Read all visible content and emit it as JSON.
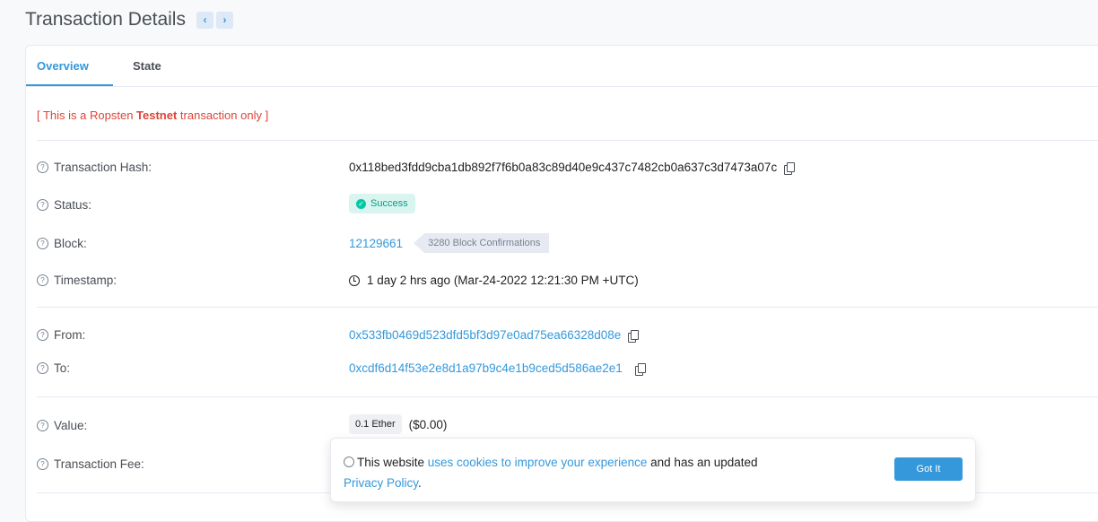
{
  "header": {
    "title": "Transaction Details",
    "prev_icon": "‹",
    "next_icon": "›"
  },
  "tabs": [
    {
      "label": "Overview"
    },
    {
      "label": "State"
    }
  ],
  "notice": {
    "prefix": "[ This is a Ropsten ",
    "strong": "Testnet",
    "suffix": " transaction only ]"
  },
  "rows": {
    "hash": {
      "label": "Transaction Hash:",
      "value": "0x118bed3fdd9cba1db892f7f6b0a83c89d40e9c437c7482cb0a637c3d7473a07c"
    },
    "status": {
      "label": "Status:",
      "value": "Success"
    },
    "block": {
      "label": "Block:",
      "value": "12129661",
      "confirmations": "3280 Block Confirmations"
    },
    "timestamp": {
      "label": "Timestamp:",
      "value": "1 day 2 hrs ago (Mar-24-2022 12:21:30 PM +UTC)"
    },
    "from": {
      "label": "From:",
      "value": "0x533fb0469d523dfd5bf3d97e0ad75ea66328d08e"
    },
    "to": {
      "label": "To:",
      "value": "0xcdf6d14f53e2e8d1a97b9c4e1b9ced5d586ae2e1"
    },
    "value": {
      "label": "Value:",
      "amount": "0.1 Ether",
      "usd": "($0.00)"
    },
    "fee": {
      "label": "Transaction Fee:"
    }
  },
  "help_glyph": "?",
  "cookie": {
    "text_before": "This website ",
    "link": "uses cookies to improve your experience",
    "text_after": " and has an updated",
    "policy_link": "Privacy Policy",
    "period": ".",
    "button": "Got It"
  },
  "colors": {
    "accent": "#3498db",
    "danger": "#de4437",
    "success": "#00c9a7"
  }
}
